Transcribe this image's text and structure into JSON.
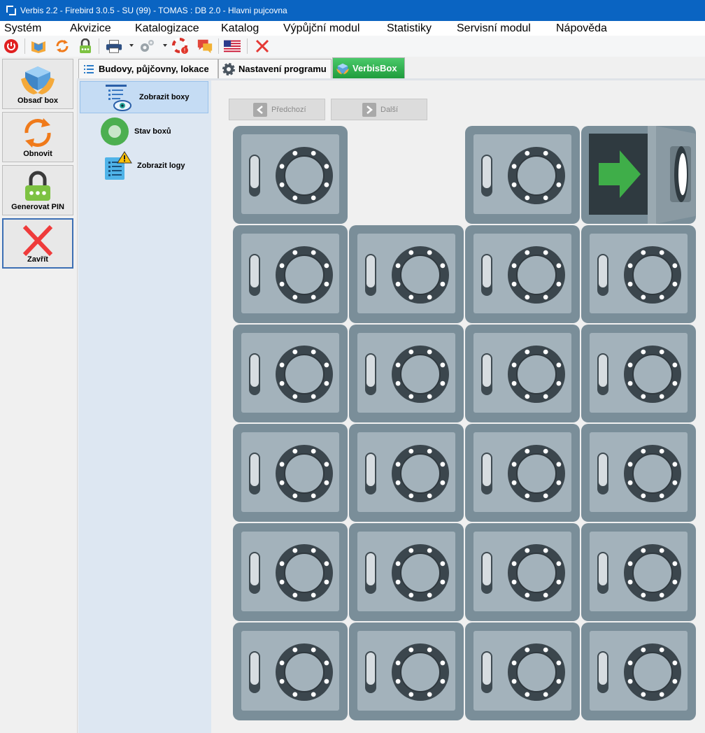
{
  "window": {
    "title": "Verbis 2.2 - Firebird 3.0.5 - SU (99) - TOMAS : DB 2.0 - Hlavni pujcovna"
  },
  "menu": {
    "items": [
      {
        "label": "Systém"
      },
      {
        "label": "Akvizice"
      },
      {
        "label": "Katalogizace"
      },
      {
        "label": "Katalog"
      },
      {
        "label": "Výpůjční modul"
      },
      {
        "label": "Statistiky"
      },
      {
        "label": "Servisní modul"
      },
      {
        "label": "Nápověda"
      }
    ]
  },
  "toolbar": {
    "icons": [
      "power-icon",
      "library-icon",
      "refresh-icon",
      "lock-icon",
      "printer-icon",
      "settings-icon",
      "help-icon",
      "messages-icon",
      "language-flag-icon",
      "close-icon"
    ]
  },
  "left_buttons": [
    {
      "label": "Obsaď box",
      "icon": "occupy-box-icon"
    },
    {
      "label": "Obnovit",
      "icon": "refresh-icon"
    },
    {
      "label": "Generovat PIN",
      "icon": "lock-pin-icon"
    },
    {
      "label": "Zavřít",
      "icon": "close-icon"
    }
  ],
  "tabs": [
    {
      "label": "Budovy, půjčovny, lokace",
      "icon": "list-icon"
    },
    {
      "label": "Nastavení programu",
      "icon": "gear-icon"
    },
    {
      "label": "VerbisBox",
      "icon": "box-icon",
      "active": true
    }
  ],
  "sidenav": [
    {
      "label": "Zobrazit boxy",
      "icon": "view-boxes-icon",
      "selected": true
    },
    {
      "label": "Stav boxů",
      "icon": "status-icon"
    },
    {
      "label": "Zobrazit logy",
      "icon": "logs-warning-icon"
    }
  ],
  "pager": {
    "prev_label": "Předchozí",
    "next_label": "Další"
  },
  "boxes": {
    "rows": 6,
    "cols": 4,
    "cells": [
      "closed",
      "empty",
      "closed",
      "open",
      "closed",
      "closed",
      "closed",
      "closed",
      "closed",
      "closed",
      "closed",
      "closed",
      "closed",
      "closed",
      "closed",
      "closed",
      "closed",
      "closed",
      "closed",
      "closed",
      "closed",
      "closed",
      "closed",
      "closed"
    ]
  },
  "colors": {
    "titlebar": "#0a64c2",
    "box_frame": "#7a8e99",
    "box_face": "#a3b2bb",
    "dial": "#3b464d",
    "arrow_green": "#3fae49",
    "tab_active": "#2faa4c"
  }
}
